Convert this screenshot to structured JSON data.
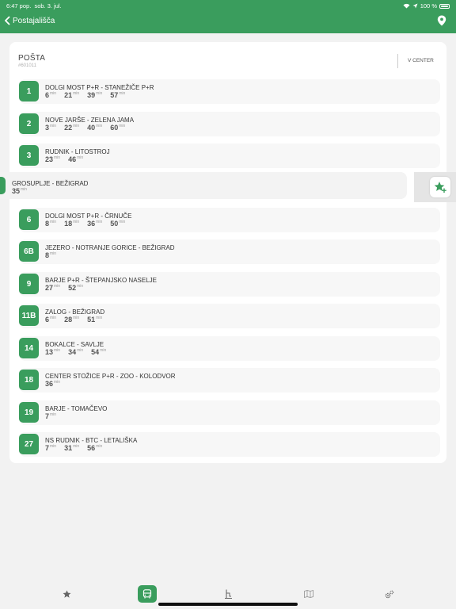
{
  "status": {
    "time": "6:47 pop.",
    "date": "sob. 3. jul.",
    "battery": "100 %"
  },
  "nav": {
    "back_label": "Postajališča"
  },
  "stop": {
    "name": "POŠTA",
    "code": "#601011",
    "direction": "V CENTER"
  },
  "unit": "min",
  "lines": [
    {
      "number": "1",
      "route": "DOLGI MOST P+R - STANEŽIČE P+R",
      "times": [
        "6",
        "21",
        "39",
        "57"
      ]
    },
    {
      "number": "2",
      "route": "NOVE JARŠE - ZELENA JAMA",
      "times": [
        "3",
        "22",
        "40",
        "60"
      ]
    },
    {
      "number": "3",
      "route": "RUDNIK - LITOSTROJ",
      "times": [
        "23",
        "46"
      ]
    },
    {
      "number": "",
      "route": "GROSUPLJE - BEŽIGRAD",
      "times": [
        "35"
      ]
    },
    {
      "number": "6",
      "route": "DOLGI MOST P+R - ČRNUČE",
      "times": [
        "8",
        "18",
        "36",
        "50"
      ]
    },
    {
      "number": "6B",
      "route": "JEZERO - NOTRANJE GORICE - BEŽIGRAD",
      "times": [
        "8"
      ]
    },
    {
      "number": "9",
      "route": "BARJE P+R - ŠTEPANJSKO NASELJE",
      "times": [
        "27",
        "52"
      ]
    },
    {
      "number": "11B",
      "route": "ZALOG - BEŽIGRAD",
      "times": [
        "6",
        "28",
        "51"
      ]
    },
    {
      "number": "14",
      "route": "BOKALCE - SAVLJE",
      "times": [
        "13",
        "34",
        "54"
      ]
    },
    {
      "number": "18",
      "route": "CENTER STOŽICE P+R - ZOO - KOLODVOR",
      "times": [
        "36"
      ]
    },
    {
      "number": "19",
      "route": "BARJE - TOMAČEVO",
      "times": [
        "7"
      ]
    },
    {
      "number": "27",
      "route": "NS RUDNIK - BTC - LETALIŠKA",
      "times": [
        "7",
        "31",
        "56"
      ]
    }
  ],
  "colors": {
    "accent": "#3a9d5d",
    "background": "#f2f2f2"
  },
  "icons": {
    "favorite_action": "star-plus-icon",
    "tabs": [
      "star-icon",
      "bus-icon",
      "stop-sign-icon",
      "map-icon",
      "settings-icon"
    ]
  }
}
